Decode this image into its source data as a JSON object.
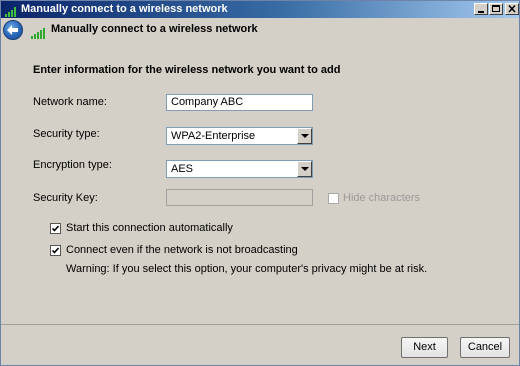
{
  "window": {
    "title": "Manually connect to a wireless network"
  },
  "header": {
    "title": "Manually connect to a wireless network"
  },
  "form": {
    "heading": "Enter information for the wireless network you want to add",
    "network_name_label": "Network name:",
    "network_name_value": "Company ABC",
    "security_type_label": "Security type:",
    "security_type_value": "WPA2-Enterprise",
    "encryption_type_label": "Encryption type:",
    "encryption_type_value": "AES",
    "security_key_label": "Security Key:",
    "security_key_value": "",
    "hide_characters_label": "Hide characters",
    "hide_characters_checked": false,
    "start_automatically_label": "Start this connection automatically",
    "start_automatically_checked": true,
    "connect_not_broadcasting_label": "Connect even if the network is not broadcasting",
    "connect_not_broadcasting_checked": true,
    "warning_text": "Warning: If you select this option, your computer's privacy might be at risk."
  },
  "footer": {
    "next_label": "Next",
    "cancel_label": "Cancel"
  },
  "icons": {
    "title": "wireless-signal-icon",
    "header": "wireless-signal-icon",
    "back": "back-arrow-icon"
  },
  "colors": {
    "titlebar_start": "#0a246a",
    "titlebar_end": "#a6caf0",
    "dialog_bg": "#d4d0c8",
    "field_border": "#7f9db9"
  }
}
